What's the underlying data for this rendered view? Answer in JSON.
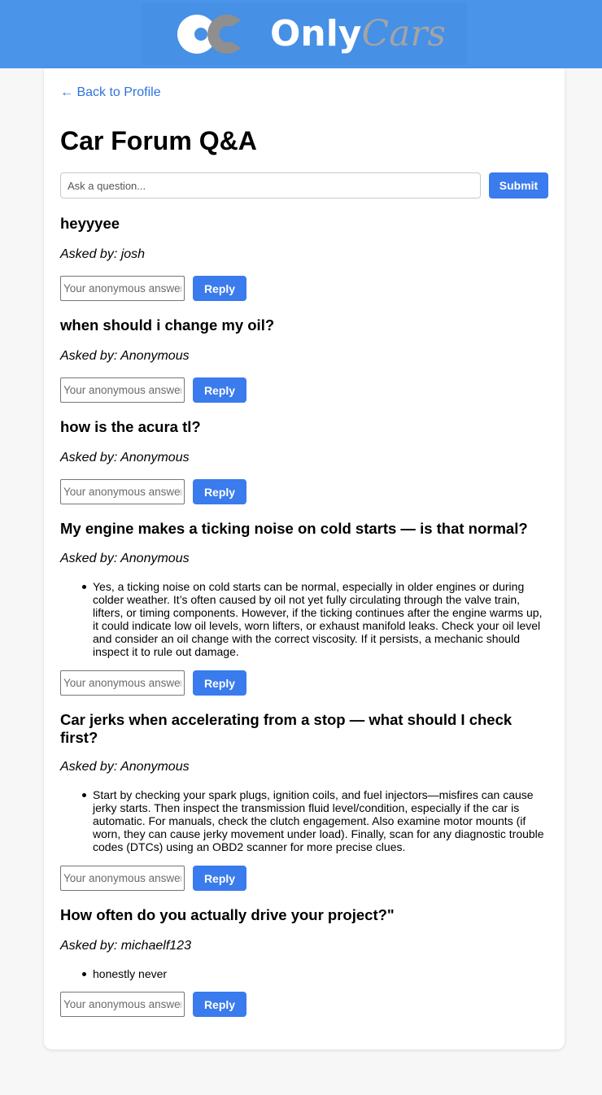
{
  "header": {
    "logo_word_primary": "Only",
    "logo_word_secondary": "Cars",
    "bar_color": "#4a95ea"
  },
  "nav": {
    "back_label": "← Back to Profile"
  },
  "page": {
    "title": "Car Forum Q&A"
  },
  "ask": {
    "placeholder": "Ask a question...",
    "submit_label": "Submit"
  },
  "reply_form": {
    "placeholder": "Your anonymous answer",
    "button_label": "Reply"
  },
  "questions": [
    {
      "title": "heyyyee",
      "author": "Asked by: josh",
      "answers": []
    },
    {
      "title": "when should i change my oil?",
      "author": "Asked by: Anonymous",
      "answers": []
    },
    {
      "title": "how is the acura tl?",
      "author": "Asked by: Anonymous",
      "answers": []
    },
    {
      "title": "My engine makes a ticking noise on cold starts — is that normal?",
      "author": "Asked by: Anonymous",
      "answers": [
        "Yes, a ticking noise on cold starts can be normal, especially in older engines or during colder weather. It’s often caused by oil not yet fully circulating through the valve train, lifters, or timing components. However, if the ticking continues after the engine warms up, it could indicate low oil levels, worn lifters, or exhaust manifold leaks. Check your oil level and consider an oil change with the correct viscosity. If it persists, a mechanic should inspect it to rule out damage."
      ]
    },
    {
      "title": "Car jerks when accelerating from a stop — what should I check first?",
      "author": "Asked by: Anonymous",
      "answers": [
        "Start by checking your spark plugs, ignition coils, and fuel injectors—misfires can cause jerky starts. Then inspect the transmission fluid level/condition, especially if the car is automatic. For manuals, check the clutch engagement. Also examine motor mounts (if worn, they can cause jerky movement under load). Finally, scan for any diagnostic trouble codes (DTCs) using an OBD2 scanner for more precise clues."
      ]
    },
    {
      "title": "How often do you actually drive your project?\"",
      "author": "Asked by: michaelf123",
      "answers": [
        "honestly never"
      ]
    }
  ]
}
